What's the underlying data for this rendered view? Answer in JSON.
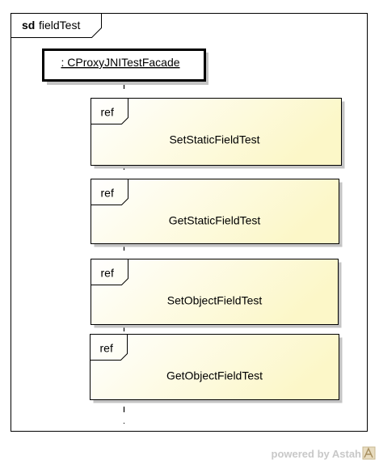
{
  "frame": {
    "keyword": "sd",
    "name": "fieldTest"
  },
  "lifeline": {
    "name": ": CProxyJNITestFacade"
  },
  "interaction_uses": [
    {
      "tag": "ref",
      "name": "SetStaticFieldTest"
    },
    {
      "tag": "ref",
      "name": "GetStaticFieldTest"
    },
    {
      "tag": "ref",
      "name": "SetObjectFieldTest"
    },
    {
      "tag": "ref",
      "name": "GetObjectFieldTest"
    }
  ],
  "watermark": {
    "text": "powered by Astah"
  },
  "colors": {
    "frame_border": "#000000",
    "ref_fill_start": "#ffffff",
    "ref_fill_end": "#fdf9d0",
    "shadow": "#c4c4c4",
    "watermark": "#c8c8c8"
  }
}
